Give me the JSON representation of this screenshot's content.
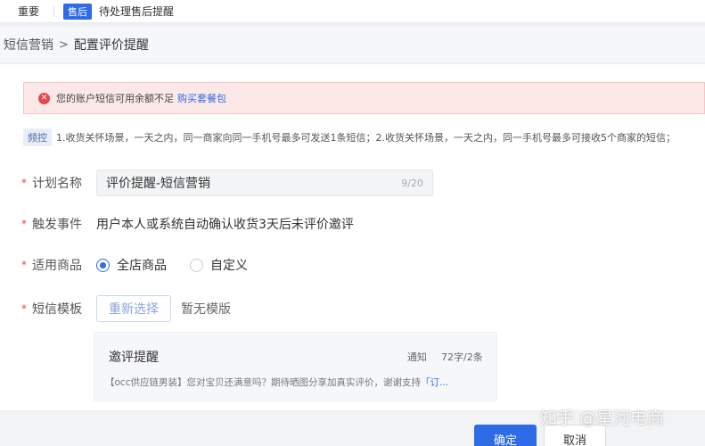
{
  "topbar": {
    "important_label": "重要",
    "badge": "售后",
    "pending_text": "待处理售后提醒"
  },
  "breadcrumb": {
    "parent": "短信营销",
    "separator": ">",
    "current": "配置评价提醒"
  },
  "alert": {
    "icon": "error-icon",
    "text": "您的账户短信可用余额不足",
    "link": "购买套餐包"
  },
  "rule": {
    "tag": "频控",
    "text": "1.收货关怀场景，一天之内，同一商家向同一手机号最多可发送1条短信；2.收货关怀场景，一天之内，同一手机号最多可接收5个商家的短信；"
  },
  "form": {
    "required_mark": "*",
    "plan_name": {
      "label": "计划名称",
      "value": "评价提醒-短信营销",
      "count": "9/20"
    },
    "trigger": {
      "label": "触发事件",
      "value": "用户本人或系统自动确认收货3天后未评价邀评"
    },
    "products": {
      "label": "适用商品",
      "options": [
        "全店商品",
        "自定义"
      ],
      "selected": "全店商品"
    },
    "sms_template": {
      "label": "短信模板",
      "reselect_button": "重新选择",
      "no_template": "暂无模版"
    }
  },
  "template_card": {
    "title": "邀评提醒",
    "type": "通知",
    "count": "72字/2条",
    "content": "【occ供应链男装】您对宝贝还满意吗？期待晒图分享加真实评价，谢谢支持",
    "content_link": "「订..."
  },
  "footer": {
    "confirm": "确定",
    "cancel": "取消"
  },
  "watermark": "知乎 @星河电商",
  "colors": {
    "primary": "#2e6be6",
    "error": "#e5484d",
    "alert_bg": "#fde8e8"
  }
}
